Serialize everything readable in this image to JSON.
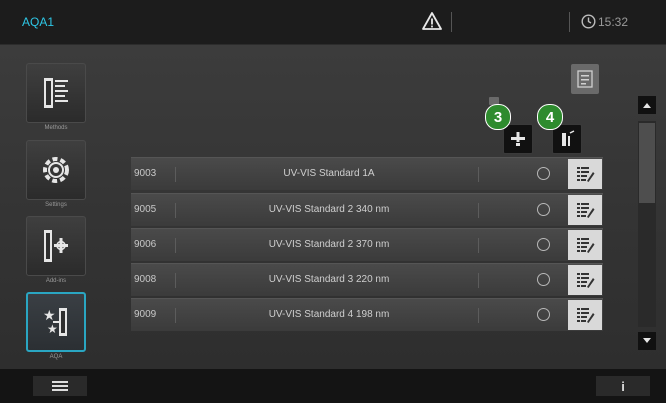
{
  "app_title": "AQA1",
  "clock_time": "15:32",
  "nav": [
    {
      "label": "Methods",
      "icon": "methods-icon"
    },
    {
      "label": "Settings",
      "icon": "settings-gear-icon"
    },
    {
      "label": "Add-ins",
      "icon": "add-ins-icon"
    },
    {
      "label": "AQA",
      "icon": "aqa-icon"
    }
  ],
  "badges": {
    "b3": "3",
    "b4": "4"
  },
  "rows": [
    {
      "num": "9003",
      "name": "UV-VIS Standard 1A"
    },
    {
      "num": "9005",
      "name": "UV-VIS Standard 2 340 nm"
    },
    {
      "num": "9006",
      "name": "UV-VIS Standard 2 370 nm"
    },
    {
      "num": "9008",
      "name": "UV-VIS Standard 3 220 nm"
    },
    {
      "num": "9009",
      "name": "UV-VIS Standard 4 198 nm"
    }
  ],
  "info_label": "i",
  "colors": {
    "accent": "#2aa6c2",
    "title": "#2ec7e6",
    "badge": "#2e8b2e"
  }
}
